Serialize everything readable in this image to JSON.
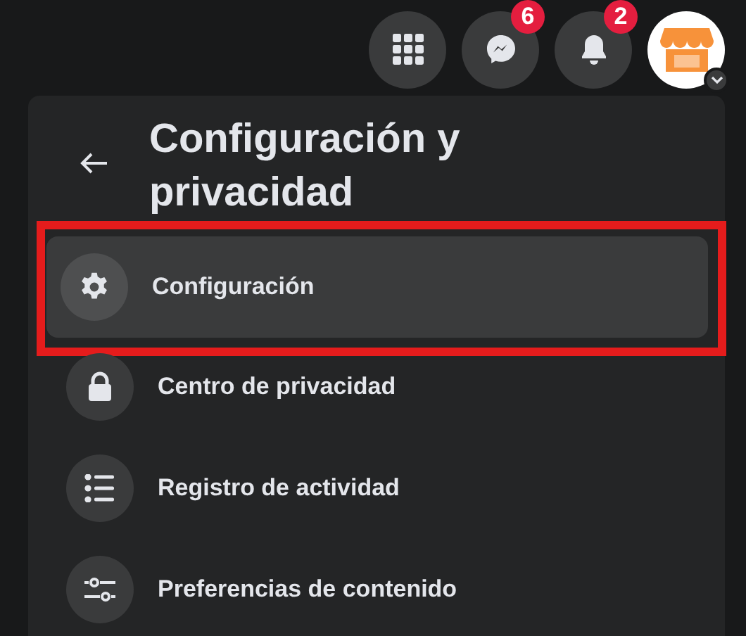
{
  "top_bar": {
    "buttons": [
      {
        "kind": "menu"
      },
      {
        "kind": "messenger",
        "badge": "6"
      },
      {
        "kind": "notifications",
        "badge": "2"
      },
      {
        "kind": "account"
      }
    ]
  },
  "panel": {
    "title": "Configuración y privacidad",
    "items": [
      {
        "label": "Configuración",
        "kind": "settings",
        "selected": true,
        "highlighted": true
      },
      {
        "label": "Centro de privacidad",
        "kind": "lock",
        "selected": false,
        "highlighted": false
      },
      {
        "label": "Registro de actividad",
        "kind": "list",
        "selected": false,
        "highlighted": false
      },
      {
        "label": "Preferencias de contenido",
        "kind": "sliders",
        "selected": false,
        "highlighted": false
      }
    ]
  }
}
